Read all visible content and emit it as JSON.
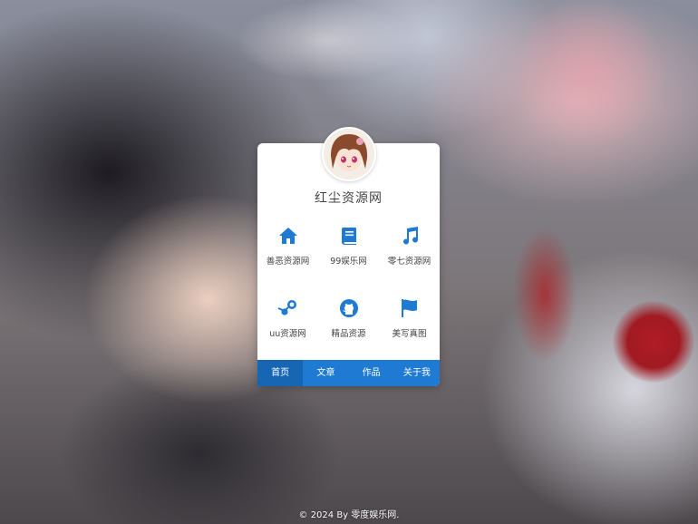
{
  "site": {
    "title": "红尘资源网"
  },
  "links": [
    {
      "label": "善恶资源网",
      "icon": "home-icon"
    },
    {
      "label": "99娱乐网",
      "icon": "book-icon"
    },
    {
      "label": "零七资源网",
      "icon": "music-icon"
    },
    {
      "label": "uu资源网",
      "icon": "steam-icon"
    },
    {
      "label": "精品资源",
      "icon": "github-icon"
    },
    {
      "label": "美写真图",
      "icon": "flag-icon"
    }
  ],
  "nav": {
    "items": [
      "首页",
      "文章",
      "作品",
      "关于我"
    ],
    "active_index": 0
  },
  "footer": {
    "text": "© 2024 By 零度娱乐网."
  },
  "colors": {
    "accent": "#1e7ad2",
    "icon": "#1e7ad2"
  }
}
